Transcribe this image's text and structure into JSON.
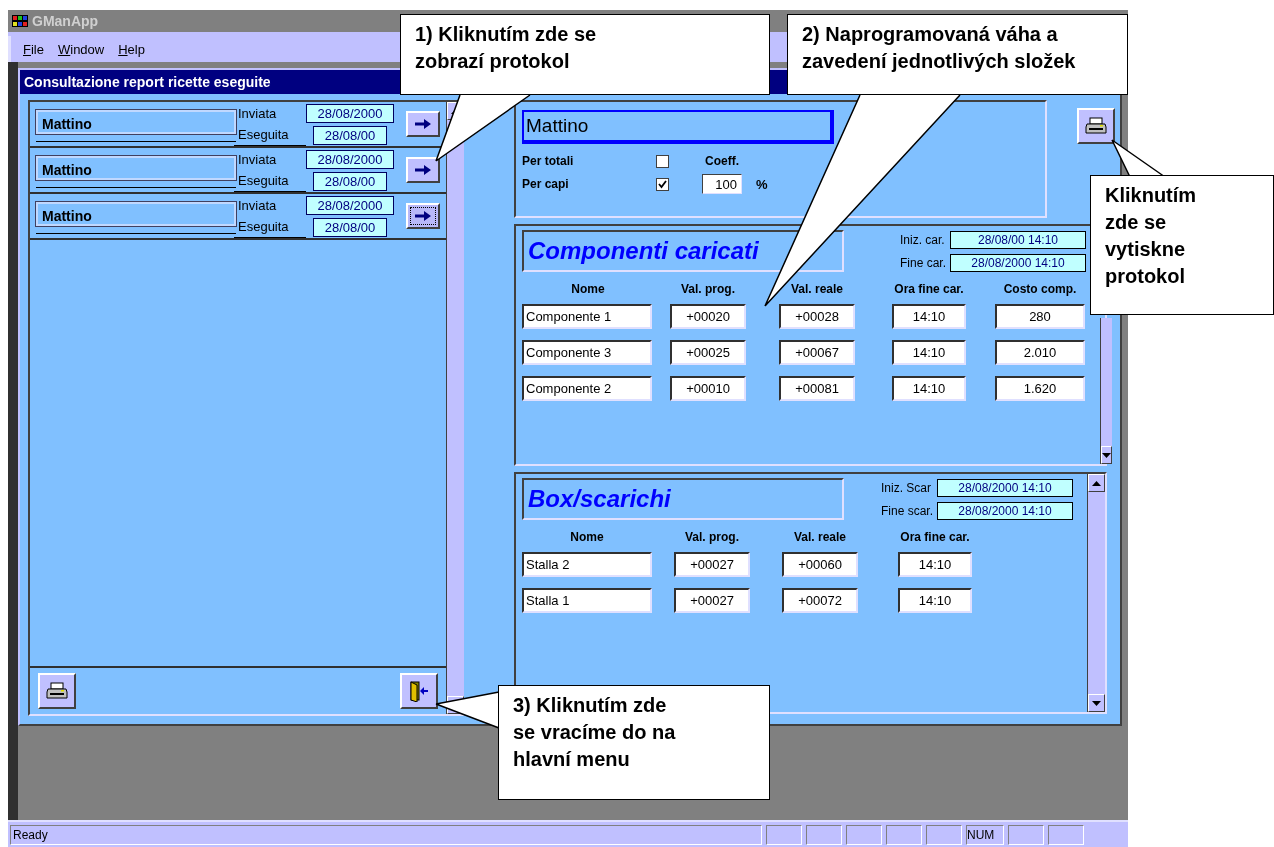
{
  "window": {
    "title": "GManApp"
  },
  "menu": [
    "File",
    "Window",
    "Help"
  ],
  "child_window": {
    "title": "Consultazione report ricette eseguite"
  },
  "recipes": [
    {
      "name": "Mattino",
      "inviata_label": "Inviata",
      "inviata": "28/08/2000",
      "eseguita_label": "Eseguita",
      "eseguita": "28/08/00",
      "focused": false
    },
    {
      "name": "Mattino",
      "inviata_label": "Inviata",
      "inviata": "28/08/2000",
      "eseguita_label": "Eseguita",
      "eseguita": "28/08/00",
      "focused": false
    },
    {
      "name": "Mattino",
      "inviata_label": "Inviata",
      "inviata": "28/08/2000",
      "eseguita_label": "Eseguita",
      "eseguita": "28/08/00",
      "focused": true
    }
  ],
  "detail": {
    "name": "Mattino",
    "per_totali": {
      "label": "Per totali",
      "checked": false
    },
    "per_capi": {
      "label": "Per capi",
      "checked": true
    },
    "coeff_label": "Coeff.",
    "coeff": "100",
    "percent": "%"
  },
  "components": {
    "title": "Componenti caricati",
    "iniz_label": "Iniz. car.",
    "iniz": "28/08/00 14:10",
    "fine_label": "Fine car.",
    "fine": "28/08/2000 14:10",
    "columns": [
      "Nome",
      "Val. prog.",
      "Val. reale",
      "Ora fine car.",
      "Costo comp."
    ],
    "rows": [
      [
        "Componente 1",
        "+00020",
        "+00028",
        "14:10",
        "280"
      ],
      [
        "Componente 3",
        "+00025",
        "+00067",
        "14:10",
        "2.010"
      ],
      [
        "Componente 2",
        "+00010",
        "+00081",
        "14:10",
        "1.620"
      ]
    ]
  },
  "unloads": {
    "title": "Box/scarichi",
    "iniz_label": "Iniz. Scar",
    "iniz": "28/08/2000 14:10",
    "fine_label": "Fine scar.",
    "fine": "28/08/2000 14:10",
    "columns": [
      "Nome",
      "Val. prog.",
      "Val. reale",
      "Ora fine car."
    ],
    "rows": [
      [
        "Stalla 2",
        "+00027",
        "+00060",
        "14:10"
      ],
      [
        "Stalla 1",
        "+00027",
        "+00072",
        "14:10"
      ]
    ]
  },
  "status_bar": {
    "text": "Ready",
    "num_indicator": "NUM"
  },
  "callouts": [
    {
      "kind": "top-left",
      "lines": [
        "1) Kliknutím zde se",
        "zobrazí protokol"
      ]
    },
    {
      "kind": "top-right",
      "lines": [
        "2) Naprogramovaná váha a",
        "zavedení jednotlivých složek"
      ]
    },
    {
      "kind": "print",
      "lines": [
        "Kliknutím",
        "zde se",
        "vytiskne",
        "protokol"
      ]
    },
    {
      "kind": "back",
      "lines": [
        "3) Kliknutím zde",
        "se vracíme do na",
        "hlavní menu"
      ]
    }
  ]
}
